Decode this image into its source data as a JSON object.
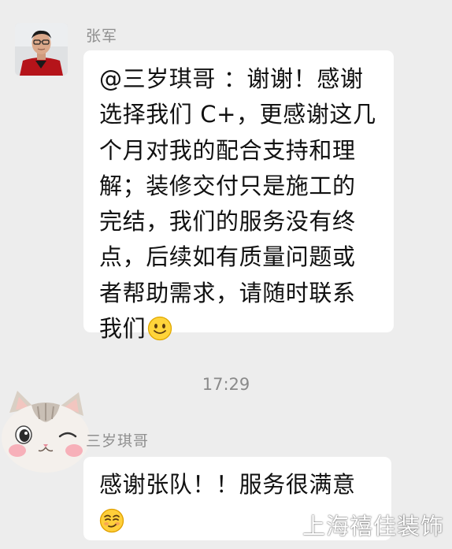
{
  "messages": [
    {
      "sender": "张军",
      "avatar": "man-avatar",
      "lines": [
        "@三岁琪哥 ：谢谢！感谢",
        "选择我们 C+，更感谢这几",
        "个月对我的配合支持和理",
        "解；装修交付只是施工的",
        "完结，我们的服务没有终",
        "点，后续如有质量问题或",
        "者帮助需求，请随时联系",
        "我们"
      ],
      "trailing_emoji": "smile-emoji"
    },
    {
      "sender": "三岁琪哥",
      "avatar": "cat-avatar",
      "lines": [
        "感谢张队！！服务很满意"
      ],
      "trailing_emoji": "smirk-emoji"
    }
  ],
  "timestamp": "17:29",
  "watermark": "上海禧佳装饰",
  "colors": {
    "background": "#ededed",
    "bubble": "#ffffff",
    "name": "#8f8f8f",
    "timestamp": "#8a8a8a"
  }
}
